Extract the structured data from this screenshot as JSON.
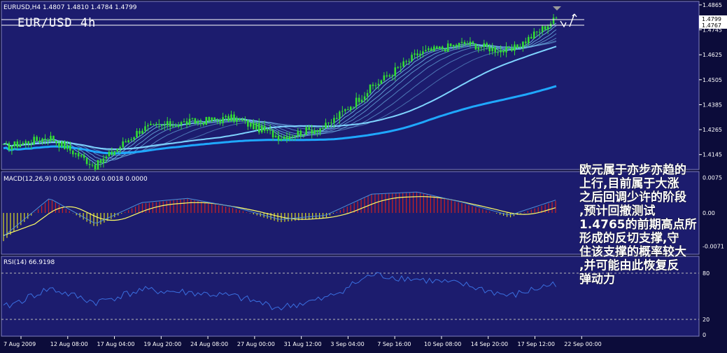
{
  "window": {
    "symbol_header": "EURUSD,H4  1.4807 1.4810 1.4784 1.4799",
    "big_title": "EUR/USD 4h"
  },
  "price_panel": {
    "current_price": "1.4799",
    "secondary_price": "1.4767",
    "ticks": [
      "1.4865",
      "1.4745",
      "1.4625",
      "1.4505",
      "1.4385",
      "1.4265",
      "1.4145"
    ],
    "tick_values": [
      1.4865,
      1.4745,
      1.4625,
      1.4505,
      1.4385,
      1.4265,
      1.4145
    ],
    "range": [
      1.408,
      1.4875
    ],
    "reference_line": 1.4767
  },
  "macd_panel": {
    "header": "MACD(12,26,9) 0.0035 0.0026 0.0018 0.0000",
    "ticks": [
      "0.0075",
      "0.00",
      "-0.0071"
    ],
    "tick_values": [
      0.0075,
      0.0,
      -0.0071
    ],
    "range": [
      -0.0085,
      0.0085
    ]
  },
  "rsi_panel": {
    "header": "RSI(14) 66.9198",
    "ticks": [
      "80",
      "20",
      "0"
    ],
    "tick_values": [
      80,
      20,
      0
    ],
    "range": [
      0,
      100
    ]
  },
  "time_axis": [
    "7 Aug 2009",
    "12 Aug 08:00",
    "17 Aug 04:00",
    "19 Aug 20:00",
    "24 Aug 08:00",
    "27 Aug 00:00",
    "31 Aug 12:00",
    "3 Sep 04:00",
    "7 Sep 16:00",
    "10 Sep 08:00",
    "14 Sep 20:00",
    "17 Sep 12:00",
    "22 Sep 00:00"
  ],
  "annotation": {
    "lines": [
      "欧元属于亦步亦趋的",
      "上行,目前属于大涨",
      "之后回调少许的阶段",
      ",预计回撤测试",
      "1.4765的前期高点所",
      "形成的反切支撑,守",
      "住该支撑的概率较大",
      ",并可能由此恢复反",
      "弹动力"
    ]
  },
  "colors": {
    "background": "#1c1c6e",
    "candles": "#33dd33",
    "ma_long": "#1fa8ff",
    "ma_ribbon": "#7fd4ff",
    "macd_positive": "#cc2222",
    "macd_negative": "#dddd22",
    "macd_signal": "#ffff66",
    "macd_line": "#4f8fd6",
    "rsi_line": "#3a6fe0",
    "grid_dashed": "#b8b8b8",
    "text": "#ffffff"
  },
  "chart_data": [
    {
      "type": "candlestick",
      "title": "EURUSD,H4",
      "series": [
        {
          "name": "EURUSD",
          "x": [
            "7 Aug 2009",
            "12 Aug 08:00",
            "17 Aug 04:00",
            "19 Aug 20:00",
            "24 Aug 08:00",
            "27 Aug 00:00",
            "31 Aug 12:00",
            "3 Sep 04:00",
            "7 Sep 16:00",
            "10 Sep 08:00",
            "14 Sep 20:00",
            "17 Sep 12:00",
            "22 Sep 00:00"
          ],
          "values": [
            1.418,
            1.423,
            1.409,
            1.427,
            1.43,
            1.432,
            1.423,
            1.428,
            1.447,
            1.463,
            1.468,
            1.464,
            1.4799
          ]
        }
      ],
      "ylim": [
        1.408,
        1.4875
      ]
    },
    {
      "type": "bar",
      "title": "MACD(12,26,9) 0.0035 0.0026 0.0018 0.0000",
      "categories": [
        "7 Aug 2009",
        "12 Aug 08:00",
        "17 Aug 04:00",
        "19 Aug 20:00",
        "24 Aug 08:00",
        "27 Aug 00:00",
        "31 Aug 12:00",
        "3 Sep 04:00",
        "7 Sep 16:00",
        "10 Sep 08:00",
        "14 Sep 20:00",
        "17 Sep 12:00",
        "22 Sep 00:00"
      ],
      "values": [
        -0.006,
        0.003,
        -0.003,
        0.002,
        0.003,
        0.001,
        -0.002,
        -0.001,
        0.004,
        0.0045,
        0.002,
        -0.001,
        0.0026
      ],
      "ylim": [
        -0.0085,
        0.0085
      ]
    },
    {
      "type": "line",
      "title": "RSI(14) 66.9198",
      "x": [
        "7 Aug 2009",
        "12 Aug 08:00",
        "17 Aug 04:00",
        "19 Aug 20:00",
        "24 Aug 08:00",
        "27 Aug 00:00",
        "31 Aug 12:00",
        "3 Sep 04:00",
        "7 Sep 16:00",
        "10 Sep 08:00",
        "14 Sep 20:00",
        "17 Sep 12:00",
        "22 Sep 00:00"
      ],
      "values": [
        35,
        60,
        42,
        58,
        55,
        50,
        35,
        47,
        78,
        72,
        65,
        50,
        66.9198
      ],
      "ylim": [
        0,
        100
      ]
    }
  ]
}
